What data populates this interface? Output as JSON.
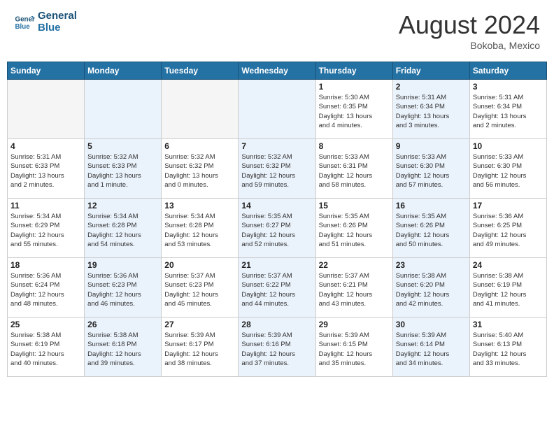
{
  "header": {
    "logo_line1": "General",
    "logo_line2": "Blue",
    "month_year": "August 2024",
    "location": "Bokoba, Mexico"
  },
  "days_of_week": [
    "Sunday",
    "Monday",
    "Tuesday",
    "Wednesday",
    "Thursday",
    "Friday",
    "Saturday"
  ],
  "weeks": [
    [
      {
        "day": "",
        "info": ""
      },
      {
        "day": "",
        "info": ""
      },
      {
        "day": "",
        "info": ""
      },
      {
        "day": "",
        "info": ""
      },
      {
        "day": "1",
        "info": "Sunrise: 5:30 AM\nSunset: 6:35 PM\nDaylight: 13 hours\nand 4 minutes."
      },
      {
        "day": "2",
        "info": "Sunrise: 5:31 AM\nSunset: 6:34 PM\nDaylight: 13 hours\nand 3 minutes."
      },
      {
        "day": "3",
        "info": "Sunrise: 5:31 AM\nSunset: 6:34 PM\nDaylight: 13 hours\nand 2 minutes."
      }
    ],
    [
      {
        "day": "4",
        "info": "Sunrise: 5:31 AM\nSunset: 6:33 PM\nDaylight: 13 hours\nand 2 minutes."
      },
      {
        "day": "5",
        "info": "Sunrise: 5:32 AM\nSunset: 6:33 PM\nDaylight: 13 hours\nand 1 minute."
      },
      {
        "day": "6",
        "info": "Sunrise: 5:32 AM\nSunset: 6:32 PM\nDaylight: 13 hours\nand 0 minutes."
      },
      {
        "day": "7",
        "info": "Sunrise: 5:32 AM\nSunset: 6:32 PM\nDaylight: 12 hours\nand 59 minutes."
      },
      {
        "day": "8",
        "info": "Sunrise: 5:33 AM\nSunset: 6:31 PM\nDaylight: 12 hours\nand 58 minutes."
      },
      {
        "day": "9",
        "info": "Sunrise: 5:33 AM\nSunset: 6:30 PM\nDaylight: 12 hours\nand 57 minutes."
      },
      {
        "day": "10",
        "info": "Sunrise: 5:33 AM\nSunset: 6:30 PM\nDaylight: 12 hours\nand 56 minutes."
      }
    ],
    [
      {
        "day": "11",
        "info": "Sunrise: 5:34 AM\nSunset: 6:29 PM\nDaylight: 12 hours\nand 55 minutes."
      },
      {
        "day": "12",
        "info": "Sunrise: 5:34 AM\nSunset: 6:28 PM\nDaylight: 12 hours\nand 54 minutes."
      },
      {
        "day": "13",
        "info": "Sunrise: 5:34 AM\nSunset: 6:28 PM\nDaylight: 12 hours\nand 53 minutes."
      },
      {
        "day": "14",
        "info": "Sunrise: 5:35 AM\nSunset: 6:27 PM\nDaylight: 12 hours\nand 52 minutes."
      },
      {
        "day": "15",
        "info": "Sunrise: 5:35 AM\nSunset: 6:26 PM\nDaylight: 12 hours\nand 51 minutes."
      },
      {
        "day": "16",
        "info": "Sunrise: 5:35 AM\nSunset: 6:26 PM\nDaylight: 12 hours\nand 50 minutes."
      },
      {
        "day": "17",
        "info": "Sunrise: 5:36 AM\nSunset: 6:25 PM\nDaylight: 12 hours\nand 49 minutes."
      }
    ],
    [
      {
        "day": "18",
        "info": "Sunrise: 5:36 AM\nSunset: 6:24 PM\nDaylight: 12 hours\nand 48 minutes."
      },
      {
        "day": "19",
        "info": "Sunrise: 5:36 AM\nSunset: 6:23 PM\nDaylight: 12 hours\nand 46 minutes."
      },
      {
        "day": "20",
        "info": "Sunrise: 5:37 AM\nSunset: 6:23 PM\nDaylight: 12 hours\nand 45 minutes."
      },
      {
        "day": "21",
        "info": "Sunrise: 5:37 AM\nSunset: 6:22 PM\nDaylight: 12 hours\nand 44 minutes."
      },
      {
        "day": "22",
        "info": "Sunrise: 5:37 AM\nSunset: 6:21 PM\nDaylight: 12 hours\nand 43 minutes."
      },
      {
        "day": "23",
        "info": "Sunrise: 5:38 AM\nSunset: 6:20 PM\nDaylight: 12 hours\nand 42 minutes."
      },
      {
        "day": "24",
        "info": "Sunrise: 5:38 AM\nSunset: 6:19 PM\nDaylight: 12 hours\nand 41 minutes."
      }
    ],
    [
      {
        "day": "25",
        "info": "Sunrise: 5:38 AM\nSunset: 6:19 PM\nDaylight: 12 hours\nand 40 minutes."
      },
      {
        "day": "26",
        "info": "Sunrise: 5:38 AM\nSunset: 6:18 PM\nDaylight: 12 hours\nand 39 minutes."
      },
      {
        "day": "27",
        "info": "Sunrise: 5:39 AM\nSunset: 6:17 PM\nDaylight: 12 hours\nand 38 minutes."
      },
      {
        "day": "28",
        "info": "Sunrise: 5:39 AM\nSunset: 6:16 PM\nDaylight: 12 hours\nand 37 minutes."
      },
      {
        "day": "29",
        "info": "Sunrise: 5:39 AM\nSunset: 6:15 PM\nDaylight: 12 hours\nand 35 minutes."
      },
      {
        "day": "30",
        "info": "Sunrise: 5:39 AM\nSunset: 6:14 PM\nDaylight: 12 hours\nand 34 minutes."
      },
      {
        "day": "31",
        "info": "Sunrise: 5:40 AM\nSunset: 6:13 PM\nDaylight: 12 hours\nand 33 minutes."
      }
    ]
  ]
}
